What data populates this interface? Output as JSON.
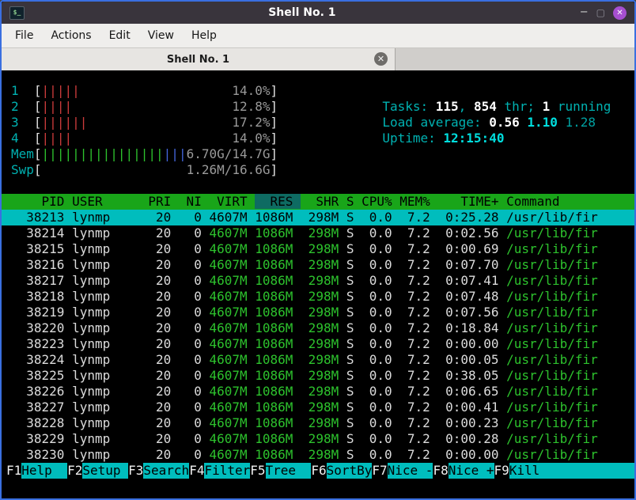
{
  "window": {
    "title": "Shell No. 1",
    "icon_glyph": "$_",
    "controls": {
      "minimize": "−",
      "maximize": "▢",
      "close": "✕"
    }
  },
  "menu": [
    "File",
    "Actions",
    "Edit",
    "View",
    "Help"
  ],
  "tab": {
    "title": "Shell No. 1",
    "close_glyph": "✕"
  },
  "htop": {
    "cpus": [
      {
        "id": "1",
        "bars": 5,
        "value": "14.0%"
      },
      {
        "id": "2",
        "bars": 4,
        "value": "12.8%"
      },
      {
        "id": "3",
        "bars": 6,
        "value": "17.2%"
      },
      {
        "id": "4",
        "bars": 4,
        "value": "14.0%"
      }
    ],
    "mem": {
      "label": "Mem",
      "green_bars": 16,
      "blue_bars": 3,
      "value": "6.70G/14.7G"
    },
    "swp": {
      "label": "Swp",
      "value": "1.26M/16.6G"
    },
    "tasks": {
      "label": "Tasks: ",
      "count": "115",
      "sep1": ", ",
      "threads": "854",
      "sep2": " thr; ",
      "running_count": "1",
      "running_label": " running"
    },
    "load": {
      "label": "Load average: ",
      "one": "0.56",
      "five": "1.10",
      "fifteen": "1.28"
    },
    "uptime": {
      "label": "Uptime: ",
      "value": "12:15:40"
    },
    "columns": [
      "PID",
      "USER",
      "PRI",
      "NI",
      "VIRT",
      "RES",
      "SHR",
      "S",
      "CPU%",
      "MEM%",
      "TIME+",
      "Command"
    ],
    "sort_column": "RES",
    "processes": [
      {
        "pid": "38213",
        "user": "lynmp",
        "pri": "20",
        "ni": "0",
        "virt": "4607M",
        "res": "1086M",
        "shr": "298M",
        "s": "S",
        "cpu": "0.0",
        "mem": "7.2",
        "time": "0:25.28",
        "command": "/usr/lib/fir",
        "selected": true
      },
      {
        "pid": "38214",
        "user": "lynmp",
        "pri": "20",
        "ni": "0",
        "virt": "4607M",
        "res": "1086M",
        "shr": "298M",
        "s": "S",
        "cpu": "0.0",
        "mem": "7.2",
        "time": "0:02.56",
        "command": "/usr/lib/fir",
        "selected": false
      },
      {
        "pid": "38215",
        "user": "lynmp",
        "pri": "20",
        "ni": "0",
        "virt": "4607M",
        "res": "1086M",
        "shr": "298M",
        "s": "S",
        "cpu": "0.0",
        "mem": "7.2",
        "time": "0:00.69",
        "command": "/usr/lib/fir",
        "selected": false
      },
      {
        "pid": "38216",
        "user": "lynmp",
        "pri": "20",
        "ni": "0",
        "virt": "4607M",
        "res": "1086M",
        "shr": "298M",
        "s": "S",
        "cpu": "0.0",
        "mem": "7.2",
        "time": "0:07.70",
        "command": "/usr/lib/fir",
        "selected": false
      },
      {
        "pid": "38217",
        "user": "lynmp",
        "pri": "20",
        "ni": "0",
        "virt": "4607M",
        "res": "1086M",
        "shr": "298M",
        "s": "S",
        "cpu": "0.0",
        "mem": "7.2",
        "time": "0:07.41",
        "command": "/usr/lib/fir",
        "selected": false
      },
      {
        "pid": "38218",
        "user": "lynmp",
        "pri": "20",
        "ni": "0",
        "virt": "4607M",
        "res": "1086M",
        "shr": "298M",
        "s": "S",
        "cpu": "0.0",
        "mem": "7.2",
        "time": "0:07.48",
        "command": "/usr/lib/fir",
        "selected": false
      },
      {
        "pid": "38219",
        "user": "lynmp",
        "pri": "20",
        "ni": "0",
        "virt": "4607M",
        "res": "1086M",
        "shr": "298M",
        "s": "S",
        "cpu": "0.0",
        "mem": "7.2",
        "time": "0:07.56",
        "command": "/usr/lib/fir",
        "selected": false
      },
      {
        "pid": "38220",
        "user": "lynmp",
        "pri": "20",
        "ni": "0",
        "virt": "4607M",
        "res": "1086M",
        "shr": "298M",
        "s": "S",
        "cpu": "0.0",
        "mem": "7.2",
        "time": "0:18.84",
        "command": "/usr/lib/fir",
        "selected": false
      },
      {
        "pid": "38223",
        "user": "lynmp",
        "pri": "20",
        "ni": "0",
        "virt": "4607M",
        "res": "1086M",
        "shr": "298M",
        "s": "S",
        "cpu": "0.0",
        "mem": "7.2",
        "time": "0:00.00",
        "command": "/usr/lib/fir",
        "selected": false
      },
      {
        "pid": "38224",
        "user": "lynmp",
        "pri": "20",
        "ni": "0",
        "virt": "4607M",
        "res": "1086M",
        "shr": "298M",
        "s": "S",
        "cpu": "0.0",
        "mem": "7.2",
        "time": "0:00.05",
        "command": "/usr/lib/fir",
        "selected": false
      },
      {
        "pid": "38225",
        "user": "lynmp",
        "pri": "20",
        "ni": "0",
        "virt": "4607M",
        "res": "1086M",
        "shr": "298M",
        "s": "S",
        "cpu": "0.0",
        "mem": "7.2",
        "time": "0:38.05",
        "command": "/usr/lib/fir",
        "selected": false
      },
      {
        "pid": "38226",
        "user": "lynmp",
        "pri": "20",
        "ni": "0",
        "virt": "4607M",
        "res": "1086M",
        "shr": "298M",
        "s": "S",
        "cpu": "0.0",
        "mem": "7.2",
        "time": "0:06.65",
        "command": "/usr/lib/fir",
        "selected": false
      },
      {
        "pid": "38227",
        "user": "lynmp",
        "pri": "20",
        "ni": "0",
        "virt": "4607M",
        "res": "1086M",
        "shr": "298M",
        "s": "S",
        "cpu": "0.0",
        "mem": "7.2",
        "time": "0:00.41",
        "command": "/usr/lib/fir",
        "selected": false
      },
      {
        "pid": "38228",
        "user": "lynmp",
        "pri": "20",
        "ni": "0",
        "virt": "4607M",
        "res": "1086M",
        "shr": "298M",
        "s": "S",
        "cpu": "0.0",
        "mem": "7.2",
        "time": "0:00.23",
        "command": "/usr/lib/fir",
        "selected": false
      },
      {
        "pid": "38229",
        "user": "lynmp",
        "pri": "20",
        "ni": "0",
        "virt": "4607M",
        "res": "1086M",
        "shr": "298M",
        "s": "S",
        "cpu": "0.0",
        "mem": "7.2",
        "time": "0:00.28",
        "command": "/usr/lib/fir",
        "selected": false
      },
      {
        "pid": "38230",
        "user": "lynmp",
        "pri": "20",
        "ni": "0",
        "virt": "4607M",
        "res": "1086M",
        "shr": "298M",
        "s": "S",
        "cpu": "0.0",
        "mem": "7.2",
        "time": "0:00.00",
        "command": "/usr/lib/fir",
        "selected": false
      }
    ],
    "fkeys": [
      {
        "key": "F1",
        "label": "Help"
      },
      {
        "key": "F2",
        "label": "Setup"
      },
      {
        "key": "F3",
        "label": "Search"
      },
      {
        "key": "F4",
        "label": "Filter"
      },
      {
        "key": "F5",
        "label": "Tree"
      },
      {
        "key": "F6",
        "label": "SortBy"
      },
      {
        "key": "F7",
        "label": "Nice -"
      },
      {
        "key": "F8",
        "label": "Nice +"
      },
      {
        "key": "F9",
        "label": "Kill"
      }
    ]
  }
}
